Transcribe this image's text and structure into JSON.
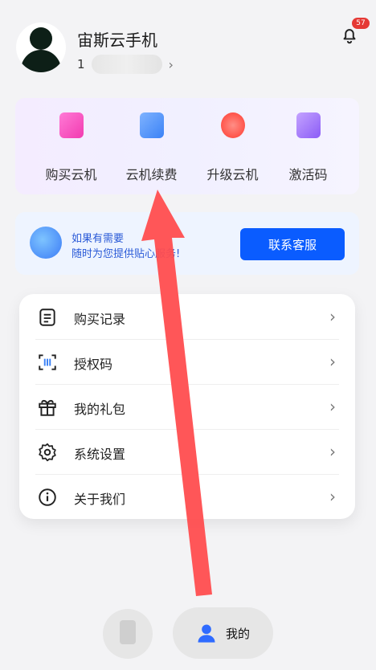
{
  "header": {
    "name": "宙斯云手机",
    "phone_prefix": "1",
    "notification_count": "57"
  },
  "actions": [
    {
      "label": "购买云机",
      "icon": "bag-icon",
      "color": "#f23bb0"
    },
    {
      "label": "云机续费",
      "icon": "card-icon",
      "color": "#3b82f6"
    },
    {
      "label": "升级云机",
      "icon": "upgrade-icon",
      "color": "#ff5a4f"
    },
    {
      "label": "激活码",
      "icon": "activation-icon",
      "color": "#8b5cf6"
    }
  ],
  "support": {
    "line1": "如果有需要",
    "line2": "随时为您提供贴心服务!",
    "button": "联系客服"
  },
  "menu": [
    {
      "label": "购买记录",
      "icon": "list-icon"
    },
    {
      "label": "授权码",
      "icon": "scan-code-icon"
    },
    {
      "label": "我的礼包",
      "icon": "gift-icon"
    },
    {
      "label": "系统设置",
      "icon": "gear-icon"
    },
    {
      "label": "关于我们",
      "icon": "info-icon"
    }
  ],
  "nav": {
    "active_label": "我的"
  },
  "colors": {
    "accent": "#0a5cff",
    "annotation": "#ff4d4f"
  }
}
